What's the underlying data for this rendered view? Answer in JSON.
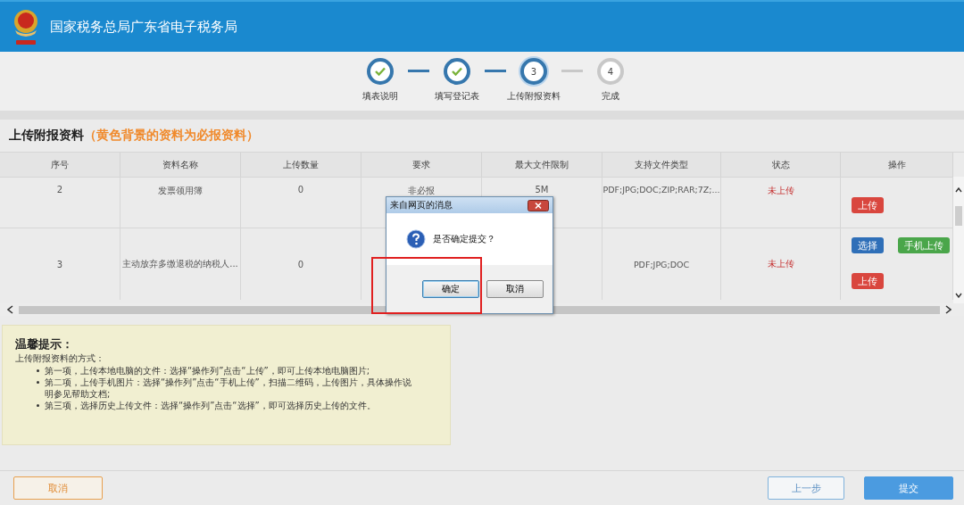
{
  "header": {
    "title": "国家税务总局广东省电子税务局"
  },
  "steps": [
    {
      "label": "填表说明",
      "completed": true,
      "selected": false
    },
    {
      "label": "填写登记表",
      "completed": true,
      "selected": false
    },
    {
      "label": "上传附报资料",
      "number": "3",
      "completed": false,
      "selected": true
    },
    {
      "label": "完成",
      "number": "4",
      "completed": false,
      "selected": false
    }
  ],
  "section": {
    "title": "上传附报资料",
    "note": "（黄色背景的资料为必报资料）"
  },
  "table": {
    "columns": [
      "序号",
      "资料名称",
      "上传数量",
      "要求",
      "最大文件限制",
      "支持文件类型",
      "状态",
      "操作"
    ],
    "rows": [
      {
        "cells": [
          "2",
          "发票领用簿",
          "0",
          "非必报",
          "5M",
          "PDF;JPG;DOC;ZIP;RAR;7Z;...",
          "未上传"
        ],
        "actions": [
          {
            "label": "上传",
            "color": "#d9463e"
          }
        ]
      },
      {
        "cells": [
          "3",
          "主动放弃多缴退税的纳税人...",
          "0",
          "",
          "",
          "PDF;JPG;DOC",
          "未上传"
        ],
        "actions": [
          {
            "label": "选择",
            "color": "#2f6fb8"
          },
          {
            "label": "手机上传",
            "color": "#4aa64a"
          },
          {
            "label": "上传",
            "color": "#d9463e"
          }
        ]
      }
    ]
  },
  "tips": {
    "title": "温馨提示：",
    "intro": "上传附报资料的方式：",
    "items": [
      "第一项，上传本地电脑的文件：选择“操作列”点击“上传”，即可上传本地电脑图片;",
      "第二项，上传手机图片：选择“操作列”点击“手机上传”，扫描二维码，上传图片，具体操作说明参见帮助文档;",
      "第三项，选择历史上传文件：选择“操作列”点击“选择”，即可选择历史上传的文件。"
    ]
  },
  "footer": {
    "cancel": "取消",
    "prev": "上一步",
    "submit": "提交"
  },
  "dialog": {
    "title": "来自网页的消息",
    "message": "是否确定提交？",
    "buttons": [
      {
        "label": "确定",
        "selected": true
      },
      {
        "label": "取消",
        "selected": false
      }
    ]
  }
}
